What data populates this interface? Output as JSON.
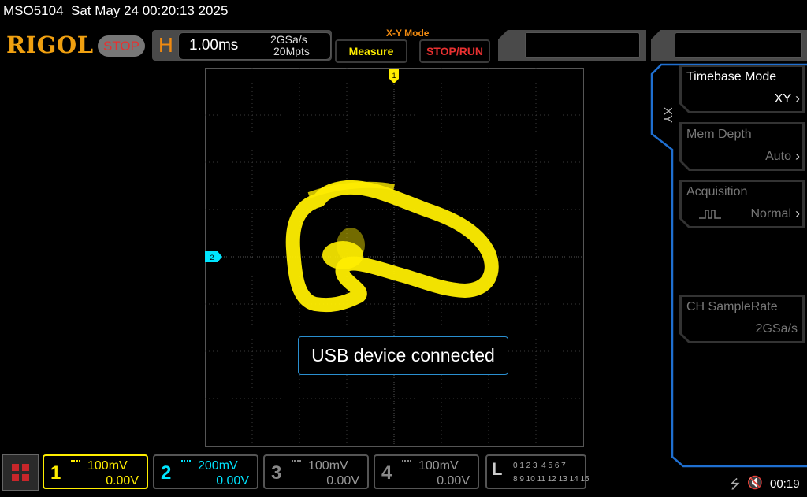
{
  "header": {
    "status_line": "MSO5104  Sat May 24 00:20:13 2025",
    "brand": "RIGOL",
    "run_state": "STOP"
  },
  "horizontal": {
    "label": "H",
    "timebase": "1.00ms",
    "sample_rate": "2GSa/s",
    "memory_depth": "20Mpts",
    "mode_title": "X-Y Mode"
  },
  "buttons": {
    "measure": "Measure",
    "stop_run": "STOP/RUN"
  },
  "markers": {
    "trigger_marker": "1",
    "ch2_marker": "2"
  },
  "menu": {
    "title": "XY",
    "items": [
      {
        "label": "Timebase Mode",
        "value": "XY",
        "state": "active"
      },
      {
        "label": "Mem Depth",
        "value": "Auto",
        "state": "dim"
      },
      {
        "label": "Acquisition",
        "value": "Normal",
        "state": "dim"
      },
      {
        "label": "CH SampleRate",
        "value": "2GSa/s",
        "state": "dim"
      }
    ]
  },
  "message": "USB device connected",
  "channels": [
    {
      "num": "1",
      "scale": "100mV",
      "offset": "0.00V",
      "color": "#ffee00",
      "active": true
    },
    {
      "num": "2",
      "scale": "200mV",
      "offset": "0.00V",
      "color": "#00e5ff",
      "active": true
    },
    {
      "num": "3",
      "scale": "100mV",
      "offset": "0.00V",
      "color": "#888888",
      "active": false
    },
    {
      "num": "4",
      "scale": "100mV",
      "offset": "0.00V",
      "color": "#888888",
      "active": false
    }
  ],
  "logic": {
    "label": "L",
    "row1": "0 1 2 3  4 5 6 7",
    "row2": "8 9 10 11 12 13 14 15"
  },
  "status_icons": {
    "usb": "usb-icon",
    "mute": "speaker-mute-icon"
  },
  "clock": "00:19",
  "colors": {
    "accent_orange": "#f08a10",
    "trace_yellow": "#ffee00",
    "ch2_cyan": "#00e5ff",
    "menu_blue": "#1f6fd0"
  }
}
